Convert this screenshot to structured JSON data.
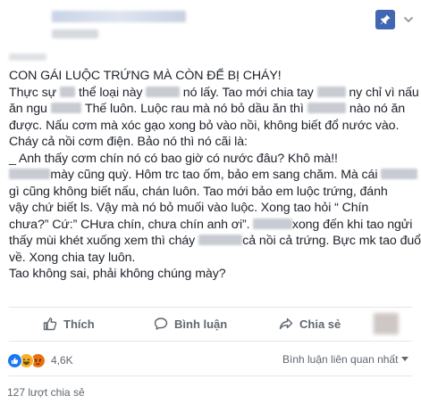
{
  "post": {
    "lines": [
      {
        "segments": [
          {
            "t": "CON GÁI LUỘC TRỨNG MÀ CÒN ĐỂ BỊ CHÁY!"
          }
        ]
      },
      {
        "segments": [
          {
            "t": "Thực sự "
          },
          {
            "b": 12
          },
          {
            "t": " thể loại này "
          },
          {
            "b": 26
          },
          {
            "t": " nó lấy. Tao mới chia tay "
          },
          {
            "b": 22
          },
          {
            "t": " ny chỉ vì nấu"
          }
        ]
      },
      {
        "segments": [
          {
            "t": "ăn ngu "
          },
          {
            "b": 24
          },
          {
            "t": " Thế luôn. Luộc rau mà nó bỏ dầu ăn thì "
          },
          {
            "b": 30
          },
          {
            "t": " nào nó ăn"
          }
        ]
      },
      {
        "segments": [
          {
            "t": "được. Nấu cơm mà xóc gạo xong bỏ vào nồi, không biết đổ nước vào."
          }
        ]
      },
      {
        "segments": [
          {
            "t": "Cháy cả nồi cơm điện. Bảo nó thì nó cãi là:"
          }
        ]
      },
      {
        "segments": [
          {
            "t": "_ Anh thấy cơm chín nó có bao giờ có nước đâu? Khô mà!!"
          }
        ]
      },
      {
        "segments": [
          {
            "b": 32
          },
          {
            "t": "mày cũng quỳ. Hôm trc tao ốm, bảo em sang chăm. Mà cái "
          },
          {
            "b": 28
          }
        ]
      },
      {
        "segments": [
          {
            "t": "gì cũng không biết nấu, chán luôn. Tao mới bảo em luộc trứng, đánh"
          }
        ]
      },
      {
        "segments": [
          {
            "t": "vậy chứ biết ls. Vậy mà nó bỏ muối vào luộc. Xong tao hỏi “ Chín"
          }
        ]
      },
      {
        "segments": [
          {
            "t": "chưa?” Cứ:” CHưa chín, chưa chín anh ơi”. "
          },
          {
            "b": 30
          },
          {
            "t": "xong đến khi tao ngửi"
          }
        ]
      },
      {
        "segments": [
          {
            "t": "thấy mùi khét xuống xem thì cháy "
          },
          {
            "b": 34
          },
          {
            "t": "cả nồi cả trứng. Bực mk tao đuổi"
          }
        ]
      },
      {
        "segments": [
          {
            "t": "về. Xong chia tay luôn."
          }
        ]
      },
      {
        "segments": [
          {
            "t": "Tao không sai, phải không chúng mày?"
          }
        ]
      }
    ]
  },
  "actions": {
    "like_label": "Thích",
    "comment_label": "Bình luận",
    "share_label": "Chia sẻ"
  },
  "reactions": {
    "count": "4,6K",
    "types": [
      "like",
      "haha",
      "angry"
    ]
  },
  "comments_filter": {
    "label": "Bình luận liên quan nhất"
  },
  "shares": {
    "label": "127 lượt chia sẻ"
  },
  "colors": {
    "accent": "#4267b2",
    "text": "#1d2129",
    "muted": "#606770",
    "like": "#1877f2",
    "haha": "#f7b125",
    "angry": "#e9710f"
  }
}
